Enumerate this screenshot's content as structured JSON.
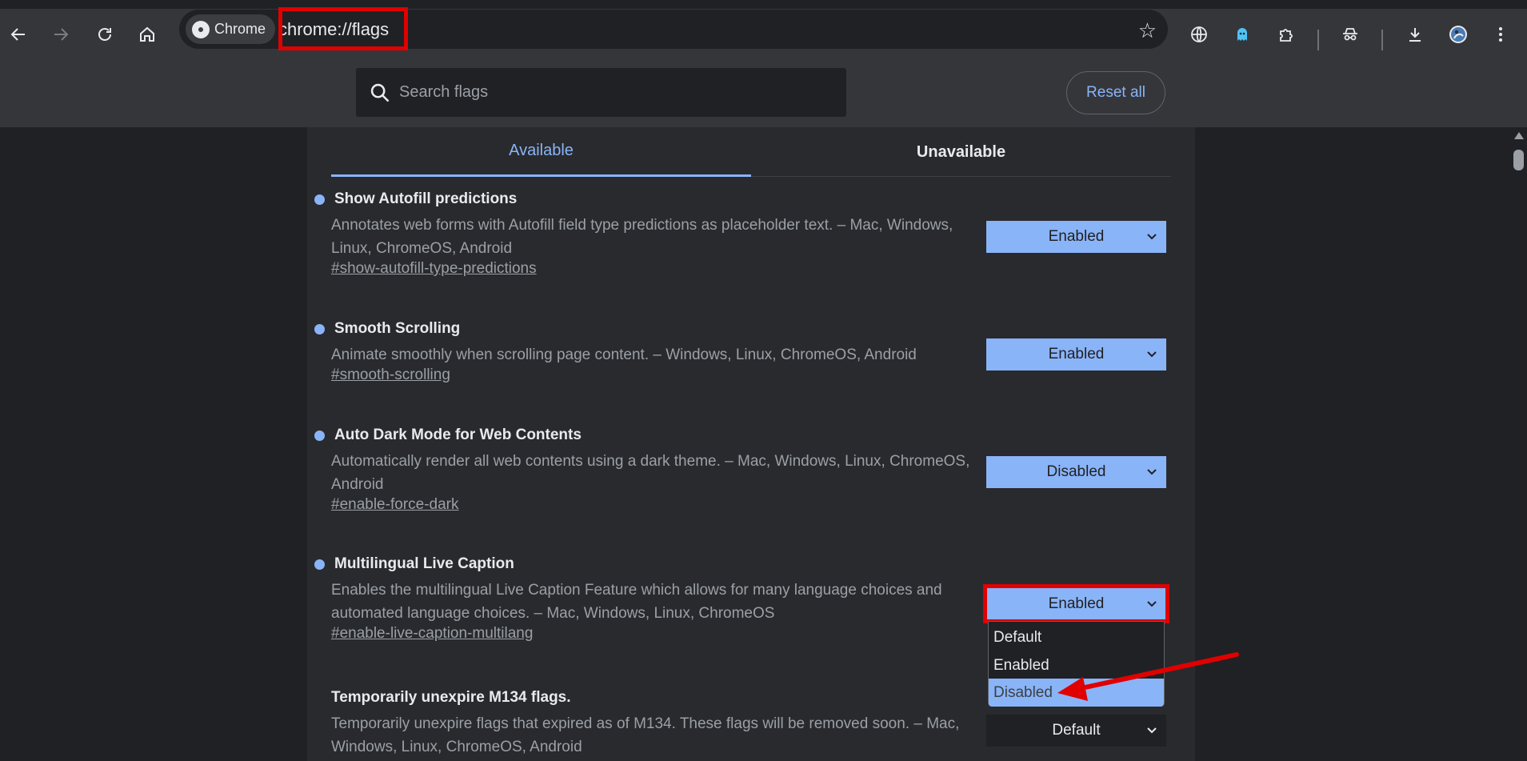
{
  "toolbar": {
    "chip_label": "Chrome",
    "url": "chrome://flags"
  },
  "header": {
    "search_placeholder": "Search flags",
    "reset_label": "Reset all"
  },
  "tabs": [
    {
      "label": "Available",
      "active": true
    },
    {
      "label": "Unavailable",
      "active": false
    }
  ],
  "flags": [
    {
      "title": "Show Autofill predictions",
      "desc": "Annotates web forms with Autofill field type predictions as placeholder text. – Mac, Windows, Linux, ChromeOS, Android",
      "link": "#show-autofill-type-predictions",
      "value": "Enabled"
    },
    {
      "title": "Smooth Scrolling",
      "desc": "Animate smoothly when scrolling page content. – Windows, Linux, ChromeOS, Android",
      "link": "#smooth-scrolling",
      "value": "Enabled"
    },
    {
      "title": "Auto Dark Mode for Web Contents",
      "desc": "Automatically render all web contents using a dark theme. – Mac, Windows, Linux, ChromeOS, Android",
      "link": "#enable-force-dark",
      "value": "Disabled"
    },
    {
      "title": "Multilingual Live Caption",
      "desc": "Enables the multilingual Live Caption Feature which allows for many language choices and automated language choices. – Mac, Windows, Linux, ChromeOS",
      "link": "#enable-live-caption-multilang",
      "value": "Enabled"
    },
    {
      "title": "Temporarily unexpire M134 flags.",
      "desc": "Temporarily unexpire flags that expired as of M134. These flags will be removed soon. – Mac, Windows, Linux, ChromeOS, Android",
      "value": "Default"
    }
  ],
  "dropdown": {
    "options": [
      "Default",
      "Enabled",
      "Disabled"
    ],
    "highlighted": "Disabled"
  },
  "colors": {
    "accent": "#8ab4f8",
    "annotation": "#e00000"
  },
  "icons": [
    "back-icon",
    "forward-icon",
    "reload-icon",
    "home-icon",
    "star-icon",
    "translate-icon",
    "ghost-extension-icon",
    "extensions-icon",
    "incognito-icon",
    "download-icon",
    "avatar",
    "menu-icon",
    "search-icon",
    "chevron-down-icon"
  ]
}
